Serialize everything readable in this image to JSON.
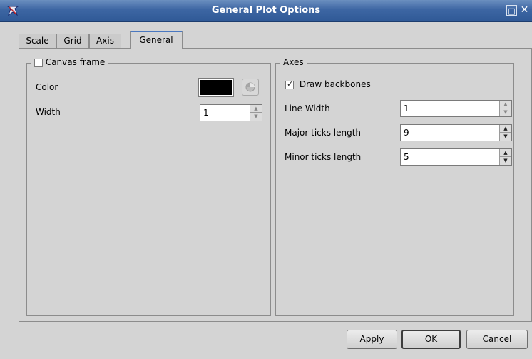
{
  "window": {
    "title": "General Plot Options",
    "maximize_glyph": "□",
    "close_glyph": "✕"
  },
  "tabs": [
    {
      "label": "Scale",
      "active": false
    },
    {
      "label": "Grid",
      "active": false
    },
    {
      "label": "Axis",
      "active": false
    },
    {
      "label": "General",
      "active": true
    }
  ],
  "canvas_frame": {
    "title": "Canvas frame",
    "checked": false,
    "color_label": "Color",
    "color_value": "#000000",
    "width_label": "Width",
    "width_value": "1"
  },
  "axes": {
    "title": "Axes",
    "draw_backbones_label": "Draw backbones",
    "draw_backbones_checked": true,
    "line_width_label": "Line Width",
    "line_width_value": "1",
    "major_ticks_label": "Major ticks length",
    "major_ticks_value": "9",
    "minor_ticks_label": "Minor ticks length",
    "minor_ticks_value": "5"
  },
  "buttons": {
    "apply_mnemonic": "A",
    "apply_rest": "pply",
    "ok_mnemonic": "O",
    "ok_rest": "K",
    "cancel_mnemonic": "C",
    "cancel_rest": "ancel"
  },
  "colors": {
    "titlebar": "#3d66a3",
    "background": "#d4d4d4",
    "active_tab_accent": "#4a78c0"
  },
  "icons": {
    "app": "app-icon",
    "maximize": "maximize-icon",
    "close": "close-icon",
    "color_picker": "color-wheel-icon",
    "spin_up": "arrow-up-icon",
    "spin_down": "arrow-down-icon"
  }
}
